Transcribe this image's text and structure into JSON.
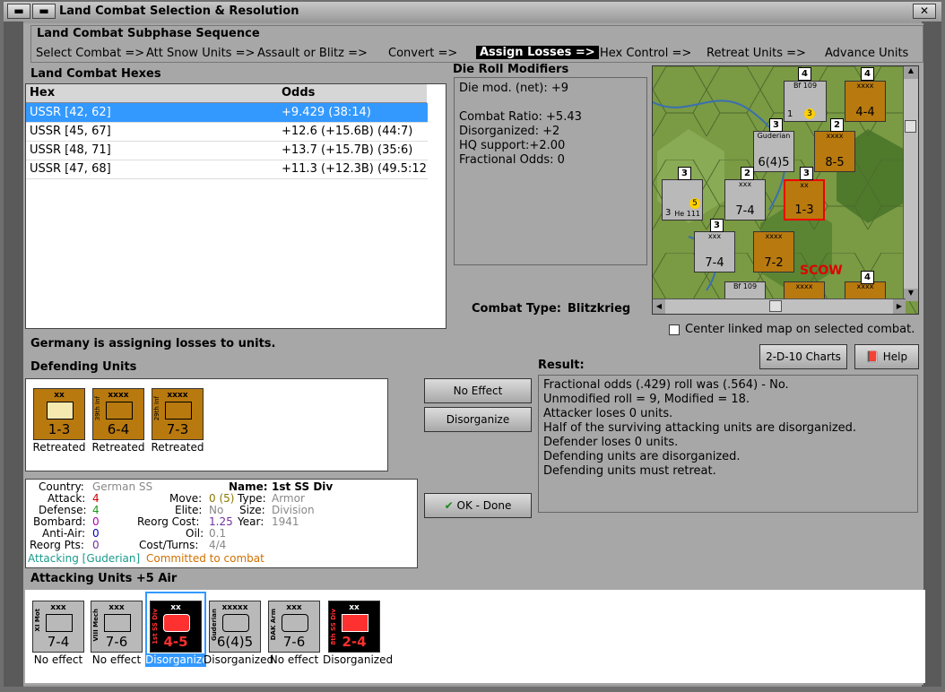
{
  "window": {
    "title": "Land Combat Selection & Resolution"
  },
  "subphase": {
    "heading": "Land Combat Subphase Sequence",
    "steps": [
      "Select Combat =>",
      "Att Snow Units =>",
      "Assault or Blitz =>",
      "Convert =>",
      "Assign Losses =>",
      "Hex Control =>",
      "Retreat Units =>",
      "Advance Units"
    ],
    "active_step": "Assign Losses =>"
  },
  "hexes": {
    "heading": "Land Combat Hexes",
    "columns": [
      "Hex",
      "Odds"
    ],
    "rows": [
      {
        "hex": "USSR [42, 62]",
        "odds": "+9.429 (38:14)"
      },
      {
        "hex": "USSR [45, 67]",
        "odds": "+12.6 (+15.6B) (44:7)"
      },
      {
        "hex": "USSR [48, 71]",
        "odds": "+13.7 (+15.7B) (35:6)"
      },
      {
        "hex": "USSR [47, 68]",
        "odds": "+11.3 (+12.3B) (49.5:12"
      }
    ]
  },
  "die_roll": {
    "heading": "Die Roll Modifiers",
    "lines": [
      "Die mod. (net): +9",
      "",
      "Combat Ratio: +5.43",
      "Disorganized: +2",
      "HQ support:+2.00",
      "Fractional Odds: 0"
    ]
  },
  "combat_type": {
    "label": "Combat Type:",
    "value": "Blitzkrieg"
  },
  "map": {
    "center_linked_label": "Center linked map on selected combat.",
    "city_label": "SCOW",
    "counters": [
      {
        "name": "Bf 109",
        "value": "1",
        "badge": "3"
      },
      {
        "name": "xxxx",
        "value": "4-4"
      },
      {
        "name": "Guderian",
        "value": "6(4)5"
      },
      {
        "name": "xxxx",
        "value": "8-5"
      },
      {
        "name": "He 111",
        "value": "3",
        "badge": "5"
      },
      {
        "name": "xxx",
        "value": "7-4"
      },
      {
        "name": "xx",
        "value": "1-3"
      },
      {
        "name": "xxx",
        "value": "7-4"
      },
      {
        "name": "xxxx",
        "value": "7-2"
      },
      {
        "name": "Bf 109",
        "value": ""
      },
      {
        "name": "xxxx",
        "value": ""
      },
      {
        "name": "xxxx",
        "value": ""
      }
    ],
    "stack_badges": [
      "4",
      "4",
      "3",
      "2",
      "3",
      "2",
      "3",
      "3",
      "4"
    ]
  },
  "status": {
    "message": "Germany is assigning losses to units."
  },
  "buttons": {
    "charts": "2-D-10 Charts",
    "help": "Help",
    "no_effect": "No Effect",
    "disorganize": "Disorganize",
    "ok_done": "OK - Done"
  },
  "defending": {
    "heading": "Defending Units",
    "units": [
      {
        "type": "xx",
        "side": "",
        "value": "1-3",
        "status": "Retreated"
      },
      {
        "type": "xxxx",
        "side": "39th Inf",
        "value": "6-4",
        "status": "Retreated"
      },
      {
        "type": "xxxx",
        "side": "29th Inf",
        "value": "7-3",
        "status": "Retreated"
      }
    ]
  },
  "result": {
    "heading": "Result:",
    "lines": [
      "Fractional odds (.429) roll was (.564)  -  No.",
      "Unmodified roll = 9, Modified = 18.",
      "Attacker loses 0 units.",
      "Half of the surviving attacking units are disorganized.",
      "Defender loses 0 units.",
      "Defending units are disorganized.",
      "Defending units must retreat."
    ]
  },
  "unit_info": {
    "country_label": "Country:",
    "country": "German SS",
    "name_label": "Name:",
    "name": "1st SS Div",
    "attack_label": "Attack:",
    "attack": "4",
    "move_label": "Move:",
    "move": "0 (5)",
    "type_label": "Type:",
    "type": "Armor",
    "defense_label": "Defense:",
    "defense": "4",
    "elite_label": "Elite:",
    "elite": "No",
    "size_label": "Size:",
    "size": "Division",
    "bombard_label": "Bombard:",
    "bombard": "0",
    "reorg_cost_label": "Reorg Cost:",
    "reorg_cost": "1.25",
    "year_label": "Year:",
    "year": "1941",
    "antiair_label": "Anti-Air:",
    "antiair": "0",
    "oil_label": "Oil:",
    "oil": "0.1",
    "reorg_pts_label": "Reorg Pts:",
    "reorg_pts": "0",
    "cost_turns_label": "Cost/Turns:",
    "cost_turns": "4/4",
    "attacking": "Attacking [Guderian]",
    "committed": "Committed to combat"
  },
  "attacking": {
    "heading": "Attacking Units +5 Air",
    "units": [
      {
        "type": "xxx",
        "side": "XI Mot",
        "value": "7-4",
        "status": "No effect",
        "color": "#b9b9b9"
      },
      {
        "type": "xxx",
        "side": "VIII Mech",
        "value": "7-6",
        "status": "No effect",
        "color": "#b9b9b9"
      },
      {
        "type": "xx",
        "side": "1st SS Div",
        "value": "4-5",
        "status": "Disorganized",
        "color": "#000000"
      },
      {
        "type": "xxxxx",
        "side": "Guderian",
        "value": "6(4)5",
        "status": "Disorganized",
        "color": "#b9b9b9"
      },
      {
        "type": "xxx",
        "side": "DAK Arm",
        "value": "7-6",
        "status": "No effect",
        "color": "#b9b9b9"
      },
      {
        "type": "xx",
        "side": "8th SS Div",
        "value": "2-4",
        "status": "Disorganized",
        "color": "#000000"
      }
    ]
  },
  "colors": {
    "selected_row": "#3399ff",
    "axis_counter": "#b9b9b9",
    "soviet_counter": "#b8790f",
    "map_green": "#6b8d3c",
    "disorganized_red": "#ff3030"
  }
}
